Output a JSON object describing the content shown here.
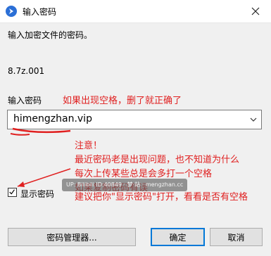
{
  "window": {
    "title": "输入密码"
  },
  "dialog": {
    "prompt": "输入加密文件的密码。",
    "filename": "8.7z.001",
    "password_label": "输入密码",
    "password_value": "himengzhan.vip",
    "show_password_label": "显示密码",
    "show_password_checked": true
  },
  "buttons": {
    "manager": "密码管理器...",
    "ok": "确定",
    "cancel": "取消"
  },
  "annotations": {
    "top": "如果出现空格，删了就正确了",
    "lines": [
      "注意！",
      "最近密码老是出现问题，也不知道为什么",
      "每次上传某些总是会多打一个空格",
      "如果复制密码有误",
      "建议把你\"显示密码\"打开，看看是否有空格"
    ],
    "color": "#e02020"
  },
  "watermark": "UP: Bilibili  ID:40849 · 梦·站 · mengzhan.cc",
  "icons": {
    "app": "app-logo-icon",
    "close": "close-icon",
    "dropdown": "chevron-down-icon",
    "checkbox": "checkmark-icon"
  }
}
